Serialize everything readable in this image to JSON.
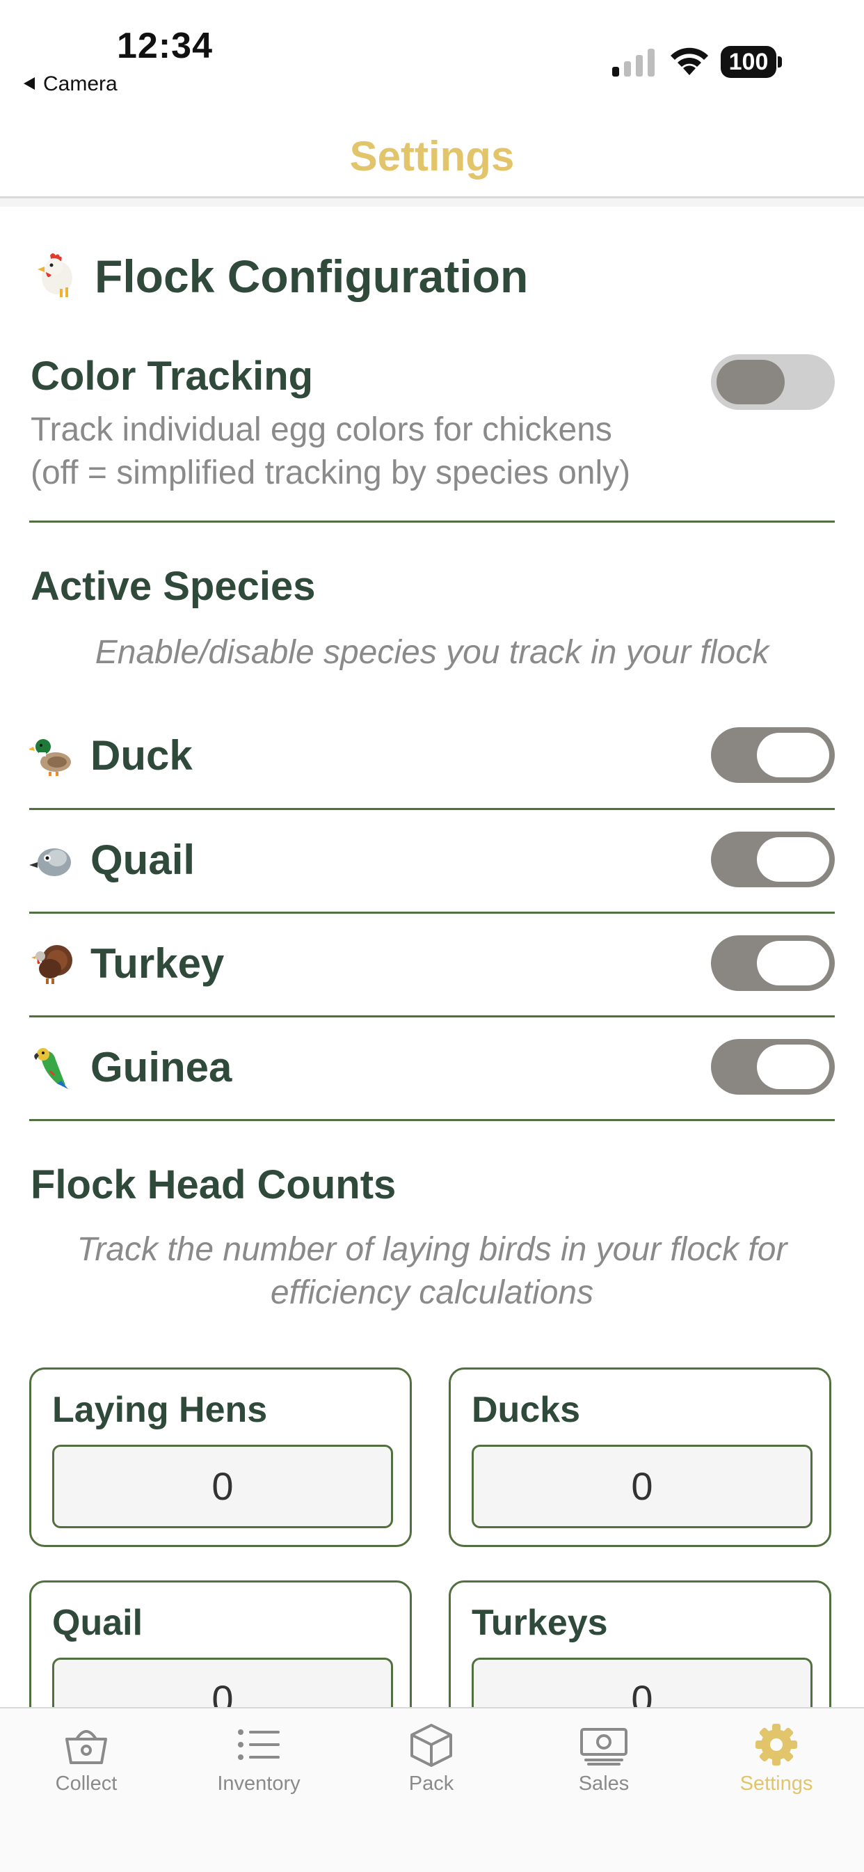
{
  "status_bar": {
    "time": "12:34",
    "back_label": "Camera",
    "battery": "100"
  },
  "nav": {
    "title": "Settings"
  },
  "flock_config": {
    "title": "Flock Configuration",
    "icon": "rooster-emoji",
    "color_tracking": {
      "title": "Color Tracking",
      "description_line1": "Track individual egg colors for chickens",
      "description_line2": "(off = simplified tracking by species only)",
      "enabled": false
    }
  },
  "active_species": {
    "title": "Active Species",
    "subtitle": "Enable/disable species you track in your flock",
    "items": [
      {
        "label": "Duck",
        "icon": "duck-emoji",
        "enabled": true
      },
      {
        "label": "Quail",
        "icon": "quail-emoji",
        "enabled": true
      },
      {
        "label": "Turkey",
        "icon": "turkey-emoji",
        "enabled": true
      },
      {
        "label": "Guinea",
        "icon": "parrot-emoji",
        "enabled": true
      }
    ]
  },
  "head_counts": {
    "title": "Flock Head Counts",
    "subtitle_line1": "Track the number of laying birds in your flock for",
    "subtitle_line2": "efficiency calculations",
    "cards": [
      {
        "label": "Laying Hens",
        "value": "0"
      },
      {
        "label": "Ducks",
        "value": "0"
      },
      {
        "label": "Quail",
        "value": "0"
      },
      {
        "label": "Turkeys",
        "value": "0"
      }
    ]
  },
  "tabs": [
    {
      "label": "Collect",
      "icon": "basket-icon",
      "active": false
    },
    {
      "label": "Inventory",
      "icon": "list-icon",
      "active": false
    },
    {
      "label": "Pack",
      "icon": "box-icon",
      "active": false
    },
    {
      "label": "Sales",
      "icon": "cash-icon",
      "active": false
    },
    {
      "label": "Settings",
      "icon": "gear-icon",
      "active": true
    }
  ],
  "colors": {
    "accent": "#e2c56a",
    "text_dark": "#2f4a3a",
    "border_green": "#52703f",
    "toggle_gray": "#8a8782"
  }
}
